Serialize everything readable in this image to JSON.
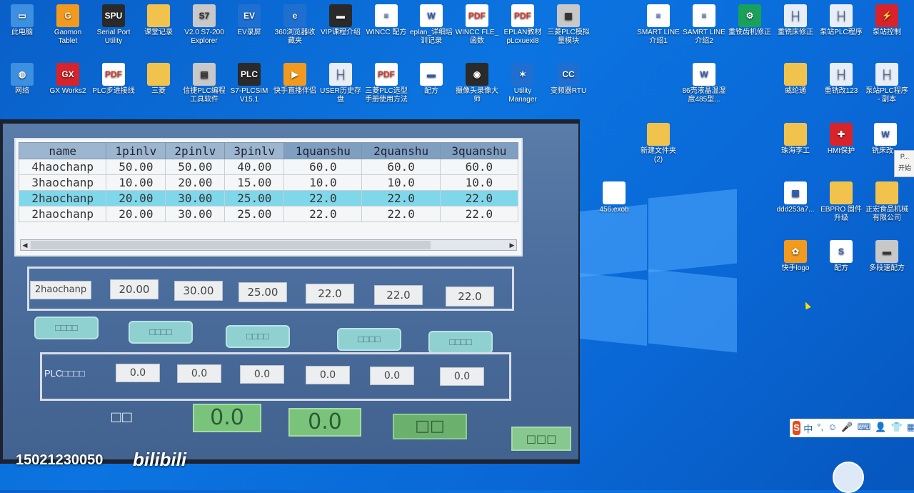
{
  "desktop_icons_row1": [
    {
      "label": "此电脑",
      "icon": "computer-icon",
      "g": "g-pc",
      "sym": "▭"
    },
    {
      "label": "Gaomon Tablet",
      "icon": "tablet-icon",
      "g": "g-orange",
      "sym": "G"
    },
    {
      "label": "Serial Port Utility",
      "icon": "serial-port-icon",
      "g": "g-app",
      "sym": "SPU"
    },
    {
      "label": "课堂记录",
      "icon": "folder-icon",
      "g": "g-folder",
      "sym": ""
    },
    {
      "label": "V2.0 S7-200 Explorer",
      "icon": "s7-explorer-icon",
      "g": "g-gray",
      "sym": "S7"
    },
    {
      "label": "EV录屏",
      "icon": "ev-recorder-icon",
      "g": "g-blue",
      "sym": "EV"
    },
    {
      "label": "360浏览器收藏夹",
      "icon": "browser-icon",
      "g": "g-blue",
      "sym": "e"
    },
    {
      "label": "VIP课程介绍",
      "icon": "video-file-icon",
      "g": "g-app",
      "sym": "▬"
    },
    {
      "label": "WINCC 配方",
      "icon": "document-icon",
      "g": "g-doc",
      "sym": "≡"
    },
    {
      "label": "eplan_详细培训记录",
      "icon": "word-icon",
      "g": "g-doc",
      "sym": "W"
    },
    {
      "label": "WINCC FLE_函数",
      "icon": "pdf-icon",
      "g": "g-pdf",
      "sym": "PDF"
    },
    {
      "label": "EPLAN教材 pLcxuexi8",
      "icon": "pdf-icon",
      "g": "g-pdf",
      "sym": "PDF"
    },
    {
      "label": "三菱PLC模拟量模块",
      "icon": "image-icon",
      "g": "g-gray",
      "sym": "▦"
    }
  ],
  "desktop_icons_row2": [
    {
      "label": "网络",
      "icon": "network-icon",
      "g": "g-pc",
      "sym": "◍"
    },
    {
      "label": "GX Works2",
      "icon": "gx-works-icon",
      "g": "g-red",
      "sym": "GX"
    },
    {
      "label": "PLC步进接线",
      "icon": "pdf-icon",
      "g": "g-pdf",
      "sym": "PDF"
    },
    {
      "label": "三菱",
      "icon": "folder-icon",
      "g": "g-folder",
      "sym": ""
    },
    {
      "label": "信捷PLC编程工具软件",
      "icon": "xinje-icon",
      "g": "g-gray",
      "sym": "▤"
    },
    {
      "label": "S7-PLCSIM V15.1",
      "icon": "plcsim-icon",
      "g": "g-app",
      "sym": "PLC"
    },
    {
      "label": "快手直播伴侣",
      "icon": "kuaishou-live-icon",
      "g": "g-orange",
      "sym": "▶"
    },
    {
      "label": "USER历史存盘",
      "icon": "ladder-file-icon",
      "g": "g-plc",
      "sym": "├┤"
    },
    {
      "label": "三菱PLC选型手册使用方法",
      "icon": "pdf-icon",
      "g": "g-pdf",
      "sym": "PDF"
    },
    {
      "label": "配方",
      "icon": "spreadsheet-icon",
      "g": "g-doc",
      "sym": "▬"
    },
    {
      "label": "摄像头录像大师",
      "icon": "camera-icon",
      "g": "g-app",
      "sym": "◉"
    },
    {
      "label": "Utility Manager",
      "icon": "utility-manager-icon",
      "g": "g-blue",
      "sym": "✶"
    },
    {
      "label": "变频器RTU",
      "icon": "ccfles-icon",
      "g": "g-blue",
      "sym": "CC"
    }
  ],
  "desktop_icons_right_row1": [
    {
      "label": "SMART LINE 介绍1",
      "icon": "document-icon",
      "g": "g-doc",
      "sym": "≡"
    },
    {
      "label": "SAMRT LINE 介绍2",
      "icon": "document-icon",
      "g": "g-doc",
      "sym": "≡"
    },
    {
      "label": "重铣齿机修正",
      "icon": "plc-file-icon",
      "g": "g-green",
      "sym": "⚙"
    },
    {
      "label": "重铣床修正",
      "icon": "ladder-file-icon",
      "g": "g-plc",
      "sym": "├┤"
    },
    {
      "label": "泵站PLC程序",
      "icon": "ladder-file-icon",
      "g": "g-plc",
      "sym": "├┤"
    },
    {
      "label": "泵站控制",
      "icon": "hmi-warning-icon",
      "g": "g-red",
      "sym": "⚡"
    }
  ],
  "desktop_icons_right_row2": [
    {
      "label": "86壳液晶温湿度485型...",
      "icon": "word-icon",
      "g": "g-doc",
      "sym": "W"
    },
    {
      "label": "威纶通",
      "icon": "folder-icon",
      "g": "g-folder",
      "sym": ""
    },
    {
      "label": "重铣改123",
      "icon": "ladder-file-icon",
      "g": "g-plc",
      "sym": "├┤"
    },
    {
      "label": "泵站PLC程序 - 副本",
      "icon": "ladder-file-icon",
      "g": "g-plc",
      "sym": "├┤"
    }
  ],
  "desktop_icons_right_row3": [
    {
      "label": "新建文件夹 (2)",
      "icon": "folder-icon",
      "g": "g-folder",
      "sym": ""
    },
    {
      "label": "珠海李工",
      "icon": "folder-icon",
      "g": "g-folder",
      "sym": ""
    },
    {
      "label": "HMI保护",
      "icon": "hmi-protect-icon",
      "g": "g-red",
      "sym": "✚"
    },
    {
      "label": "铣床改...",
      "icon": "word-icon",
      "g": "g-doc",
      "sym": "W"
    }
  ],
  "desktop_icons_right_row4": [
    {
      "label": "456.exob",
      "icon": "file-icon",
      "g": "g-doc",
      "sym": ""
    },
    {
      "label": "ddd253a7...",
      "icon": "qr-image-icon",
      "g": "g-doc",
      "sym": "▦"
    },
    {
      "label": "EBPRO 固件升级",
      "icon": "folder-icon",
      "g": "g-folder",
      "sym": ""
    },
    {
      "label": "正宏食品机械有限公司",
      "icon": "folder-icon",
      "g": "g-folder",
      "sym": ""
    }
  ],
  "desktop_icons_right_row5": [
    {
      "label": "快手logo",
      "icon": "kuaishou-icon",
      "g": "g-orange",
      "sym": "✿"
    },
    {
      "label": "配方",
      "icon": "spreadsheet-icon",
      "g": "g-doc",
      "sym": "S"
    },
    {
      "label": "多段速配方",
      "icon": "spreadsheet-icon",
      "g": "g-gray",
      "sym": "▬"
    }
  ],
  "hmi": {
    "table_headers": [
      "name",
      "1pinlv",
      "2pinlv",
      "3pinlv",
      "1quanshu",
      "2quanshu",
      "3quanshu"
    ],
    "table_rows": [
      [
        "4haochanp",
        "50.00",
        "50.00",
        "40.00",
        "60.0",
        "60.0",
        "60.0"
      ],
      [
        "3haochanp",
        "10.00",
        "20.00",
        "15.00",
        "10.0",
        "10.0",
        "10.0"
      ],
      [
        "2haochanp",
        "20.00",
        "30.00",
        "25.00",
        "22.0",
        "22.0",
        "22.0"
      ],
      [
        "2haochanp",
        "20.00",
        "30.00",
        "25.00",
        "22.0",
        "22.0",
        "22.0"
      ]
    ],
    "selected_row": 2,
    "edit_name": "2haochanp",
    "edit_values": [
      "20.00",
      "30.00",
      "25.00",
      "22.0",
      "22.0",
      "22.0"
    ],
    "buttons": [
      "□□□□",
      "□□□□",
      "□□□□",
      "□□□□",
      "□□□□"
    ],
    "plc_label": "PLC□□□□",
    "plc_values": [
      "0.0",
      "0.0",
      "0.0",
      "0.0",
      "0.0",
      "0.0"
    ],
    "bottom_label": "□□",
    "green_values": [
      "0.0",
      "0.0"
    ],
    "bottom_button": "□□",
    "corner_button": "□□□"
  },
  "watermark": {
    "phone": "15021230050",
    "site": "bilibili"
  },
  "side_button": {
    "small": "P...",
    "label": "开始"
  },
  "ime_toolbar": {
    "logo": "S",
    "items": [
      "中",
      "°,",
      "☺",
      "🎤",
      "⌨",
      "👤",
      "👕",
      "▦"
    ]
  }
}
